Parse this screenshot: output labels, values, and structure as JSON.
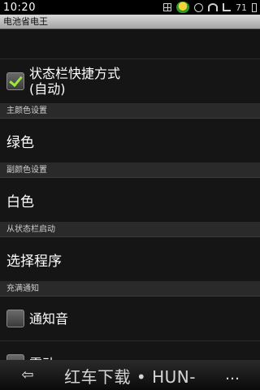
{
  "statusbar": {
    "time": "10:20",
    "battery_text": "71",
    "icons": [
      "apps-icon",
      "app-badge-icon",
      "alarm-icon",
      "wifi-icon",
      "signal-icon",
      "battery-icon"
    ]
  },
  "app": {
    "title": "电池省电王"
  },
  "settings": {
    "statusbar_shortcut": {
      "label_line1": "状态栏快捷方式",
      "label_line2": "(自动)",
      "checked": true
    },
    "primary_color_header": "主颜色设置",
    "primary_color_value": "绿色",
    "secondary_color_header": "副颜色设置",
    "secondary_color_value": "白色",
    "launch_header": "从状态栏启动",
    "launch_value": "选择程序",
    "charge_header": "充满通知",
    "notify_sound": {
      "label": "通知音",
      "checked": false
    },
    "vibrate": {
      "label": "震动",
      "checked": false
    }
  },
  "watermark": {
    "text": "红车下载 • HUN-CHE.COM"
  },
  "colors": {
    "accent_check": "#9be83a",
    "title_bar": "#c0c0c0",
    "background": "#141414"
  }
}
